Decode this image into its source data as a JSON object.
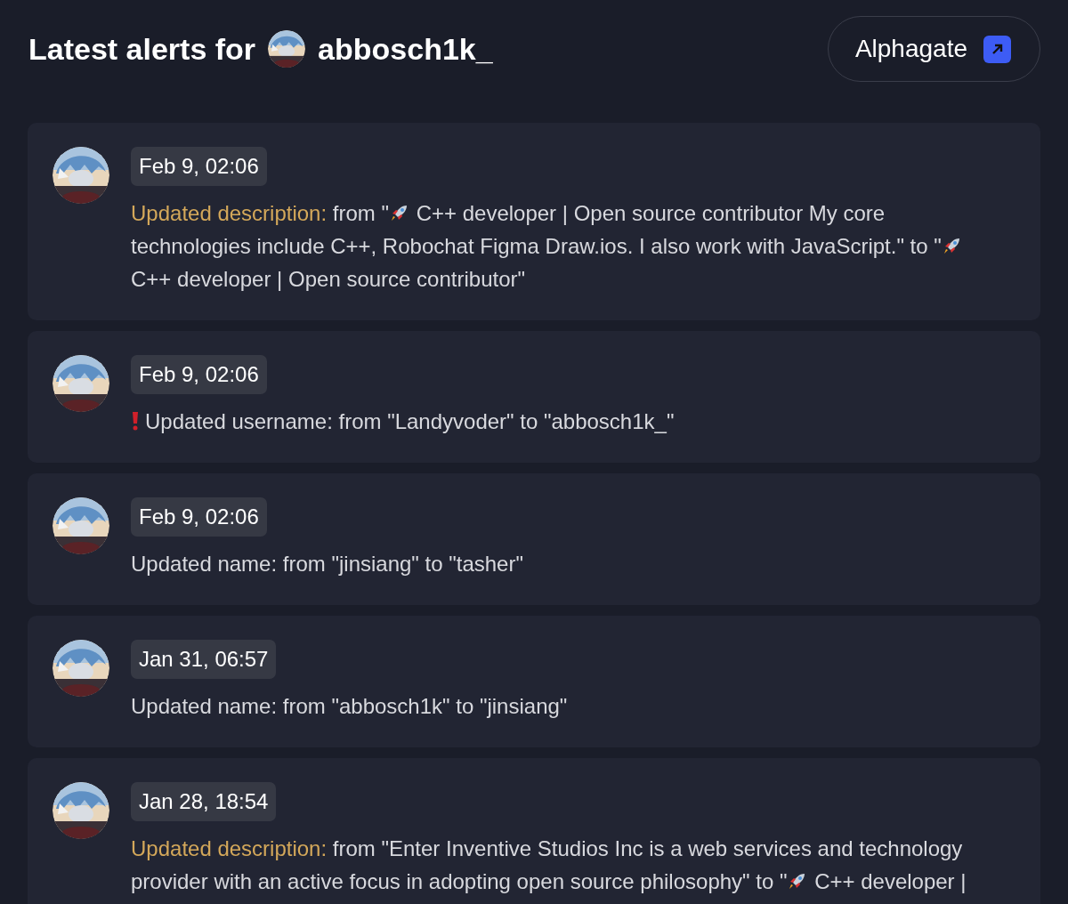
{
  "header": {
    "title": "Latest alerts for",
    "username": "abbosch1k_",
    "link": {
      "label": "Alphagate"
    }
  },
  "alerts": [
    {
      "date": "Feb 9, 02:06",
      "alert": false,
      "label": "Updated description:",
      "highlighted": true,
      "parts": [
        {
          "kind": "text",
          "text": "from \""
        },
        {
          "kind": "rocket"
        },
        {
          "kind": "text",
          "text": " C++ developer | Open source contributor My core technologies include C++, Robochat Figma Draw.ios. I also work with JavaScript.\" to \""
        },
        {
          "kind": "rocket"
        },
        {
          "kind": "text",
          "text": " C++ developer | Open source contributor\""
        }
      ]
    },
    {
      "date": "Feb 9, 02:06",
      "alert": true,
      "label": "Updated username:",
      "highlighted": false,
      "parts": [
        {
          "kind": "text",
          "text": "from \"Landyvoder\" to \"abbosch1k_\""
        }
      ]
    },
    {
      "date": "Feb 9, 02:06",
      "alert": false,
      "label": "Updated name:",
      "highlighted": false,
      "parts": [
        {
          "kind": "text",
          "text": "from \"jinsiang\" to \"tasher\""
        }
      ]
    },
    {
      "date": "Jan 31, 06:57",
      "alert": false,
      "label": "Updated name:",
      "highlighted": false,
      "parts": [
        {
          "kind": "text",
          "text": "from \"abbosch1k\" to \"jinsiang\""
        }
      ]
    },
    {
      "date": "Jan 28, 18:54",
      "alert": false,
      "label": "Updated description:",
      "highlighted": true,
      "parts": [
        {
          "kind": "text",
          "text": "from \"Enter Inventive Studios Inc is a web services and technology provider with an active focus in adopting open source philosophy\" to \""
        },
        {
          "kind": "rocket"
        },
        {
          "kind": "text",
          "text": " C++ developer |"
        }
      ]
    }
  ]
}
